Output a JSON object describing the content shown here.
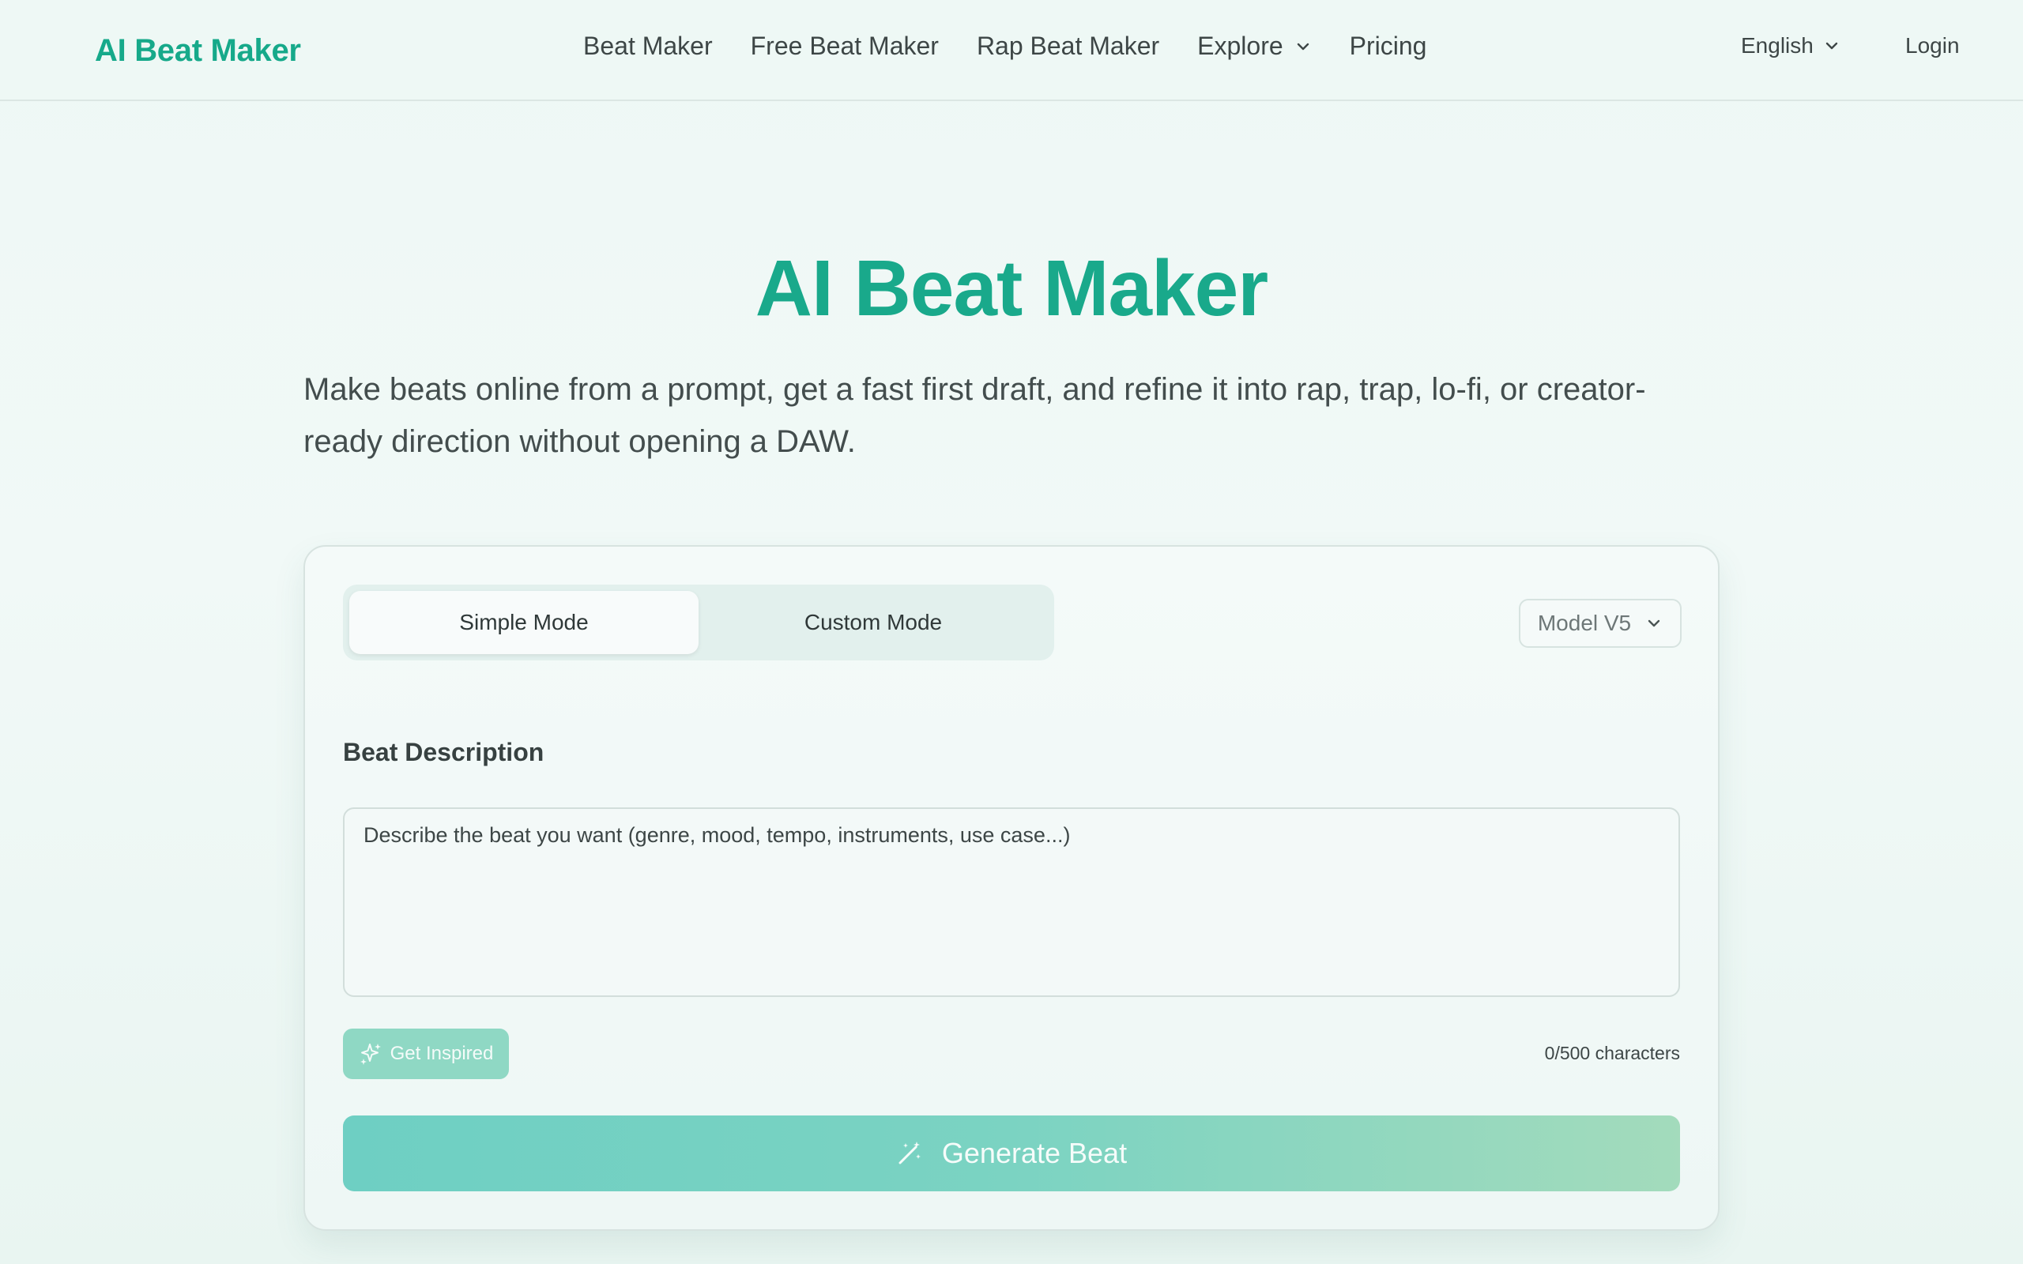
{
  "nav": {
    "brand_name": "AI Beat Maker",
    "brand_icon": "waveform-icon",
    "links": [
      {
        "label": "Beat Maker"
      },
      {
        "label": "Free Beat Maker"
      },
      {
        "label": "Rap Beat Maker"
      },
      {
        "label": "Explore",
        "has_dropdown": true
      },
      {
        "label": "Pricing"
      }
    ],
    "language": "English",
    "login": "Login"
  },
  "hero": {
    "title": "AI Beat Maker",
    "subtitle": "Make beats online from a prompt, get a fast first draft, and refine it into rap, trap, lo-fi, or creator-ready direction without opening a DAW."
  },
  "form": {
    "modes": [
      {
        "label": "Simple Mode",
        "active": true
      },
      {
        "label": "Custom Mode",
        "active": false
      }
    ],
    "model": "Model V5",
    "description_label": "Beat Description",
    "description_placeholder": "Describe the beat you want (genre, mood, tempo, instruments, use case...)",
    "description_value": "",
    "inspire_label": "Get Inspired",
    "char_count": "0/500 characters",
    "generate_label": "Generate Beat"
  },
  "colors": {
    "brand": "#19a98b",
    "generate_start": "#6ecfc3",
    "generate_end": "#a3dbbc",
    "inspire": "#8fd8c4"
  }
}
